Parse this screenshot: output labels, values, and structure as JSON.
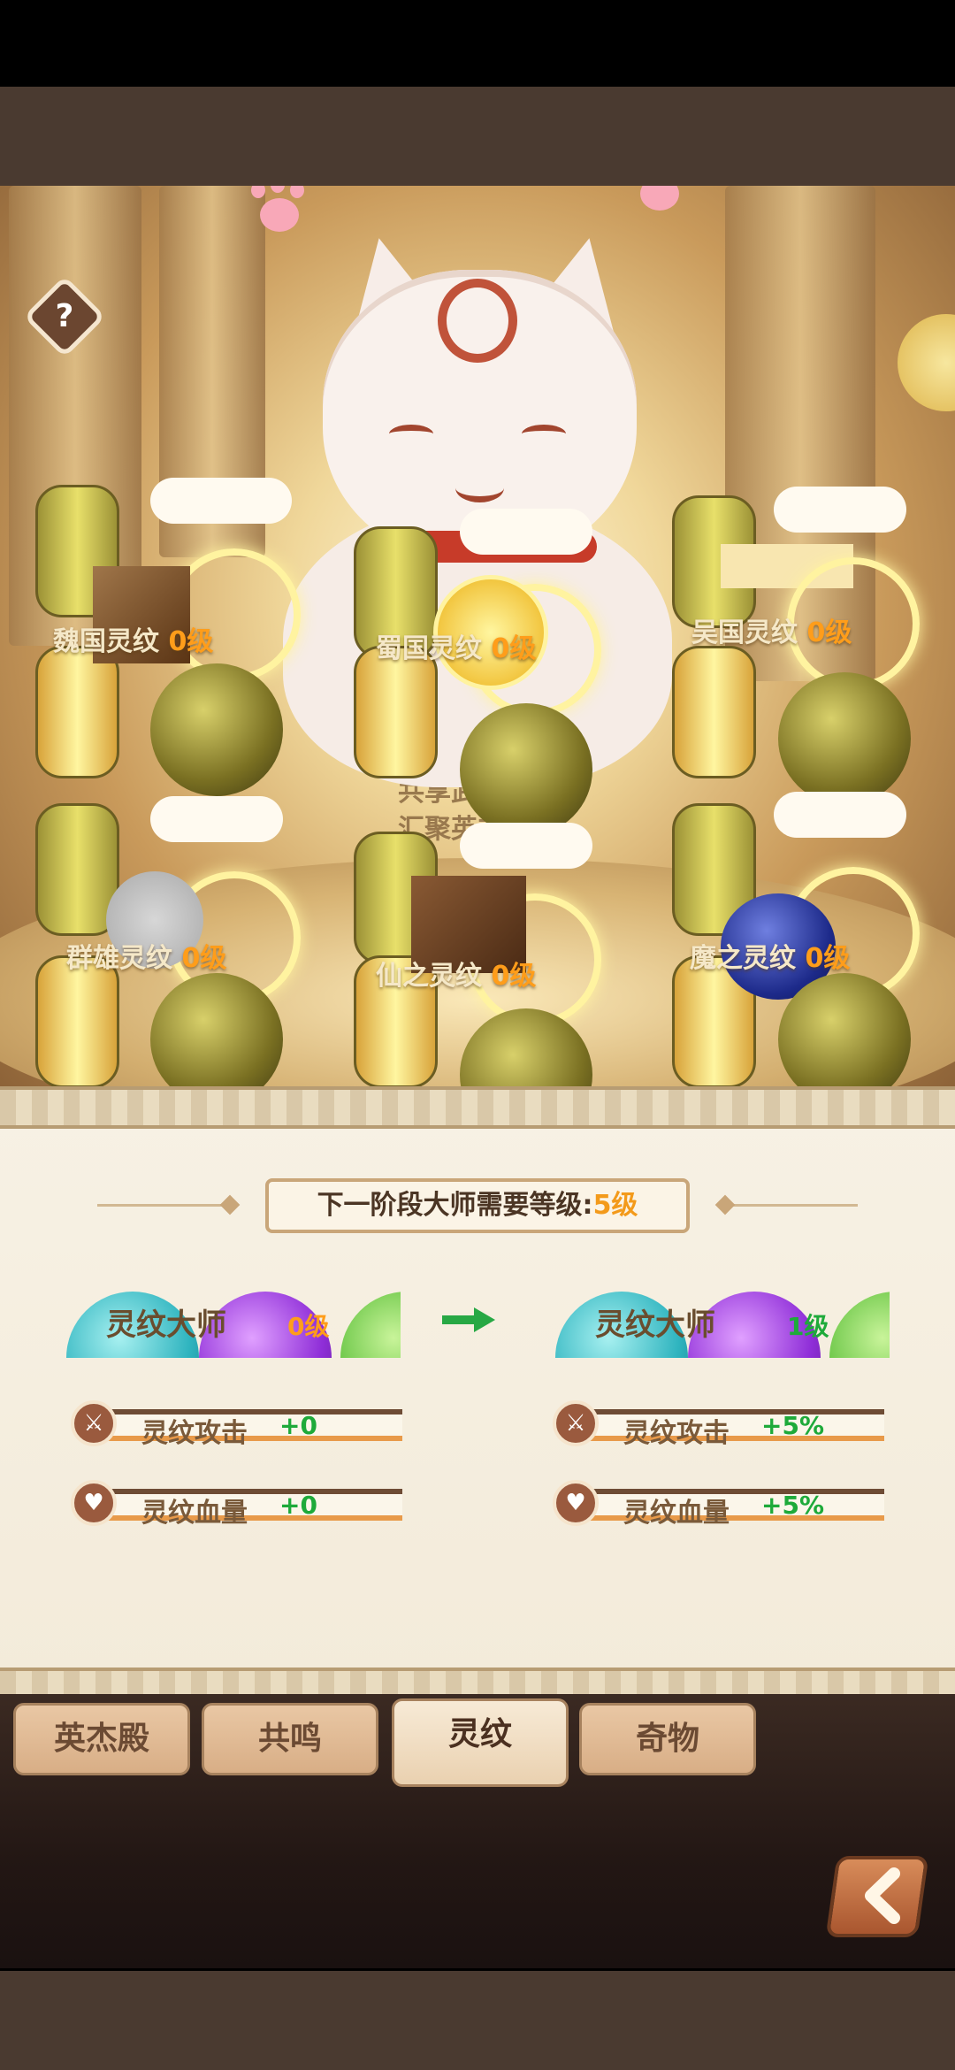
{
  "slots": [
    {
      "name": "魏国灵纹",
      "level": "0级"
    },
    {
      "name": "蜀国灵纹",
      "level": "0级"
    },
    {
      "name": "吴国灵纹",
      "level": "0级"
    },
    {
      "name": "群雄灵纹",
      "level": "0级"
    },
    {
      "name": "仙之灵纹",
      "level": "0级"
    },
    {
      "name": "魔之灵纹",
      "level": "0级"
    }
  ],
  "inscription": {
    "line1": "共享武将等级",
    "line2": "汇聚英杰之力"
  },
  "help": {
    "symbol": "?"
  },
  "stage": {
    "prefix": "下一阶段大师需要等级:",
    "value": "5级"
  },
  "master": {
    "current": {
      "title": "灵纹大师",
      "level": "0级"
    },
    "next": {
      "title": "灵纹大师",
      "level": "1级"
    }
  },
  "stats": {
    "current": [
      {
        "label": "灵纹攻击",
        "value": "+0",
        "icon": "sword-icon"
      },
      {
        "label": "灵纹血量",
        "value": "+0",
        "icon": "heart-icon"
      }
    ],
    "next": [
      {
        "label": "灵纹攻击",
        "value": "+5%",
        "icon": "sword-icon"
      },
      {
        "label": "灵纹血量",
        "value": "+5%",
        "icon": "heart-icon"
      }
    ]
  },
  "tabs": [
    {
      "label": "英杰殿",
      "active": false
    },
    {
      "label": "共鸣",
      "active": false
    },
    {
      "label": "灵纹",
      "active": true
    },
    {
      "label": "奇物",
      "active": false
    }
  ],
  "colors": {
    "level": "#ff9d1a",
    "bonus": "#1eaa3a",
    "accent": "#f39a1a"
  }
}
